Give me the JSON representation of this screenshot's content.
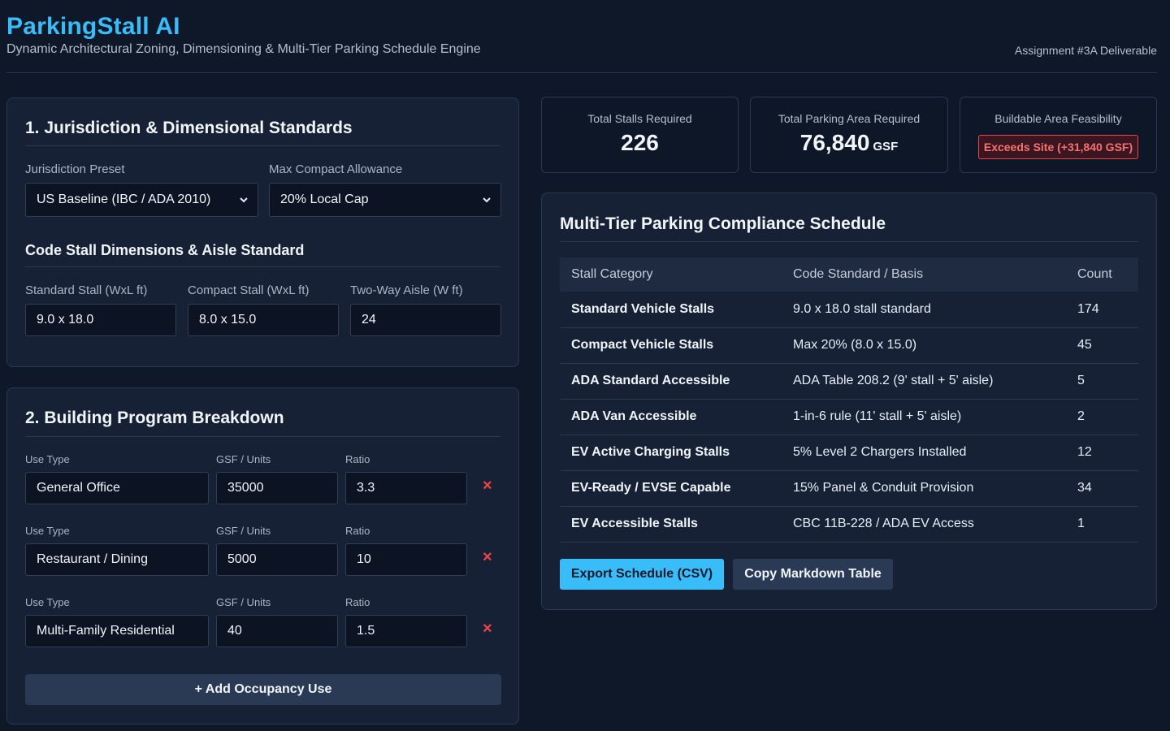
{
  "header": {
    "title": "ParkingStall AI",
    "subtitle": "Dynamic Architectural Zoning, Dimensioning & Multi-Tier Parking Schedule Engine",
    "assignment": "Assignment #3A Deliverable"
  },
  "jurisdiction": {
    "title": "1. Jurisdiction & Dimensional Standards",
    "preset_label": "Jurisdiction Preset",
    "preset_value": "US Baseline (IBC / ADA 2010)",
    "compact_label": "Max Compact Allowance",
    "compact_value": "20% Local Cap",
    "dims_title": "Code Stall Dimensions & Aisle Standard",
    "standard_label": "Standard Stall (WxL ft)",
    "standard_value": "9.0 x 18.0",
    "compact_stall_label": "Compact Stall (WxL ft)",
    "compact_stall_value": "8.0 x 15.0",
    "aisle_label": "Two-Way Aisle (W ft)",
    "aisle_value": "24"
  },
  "program": {
    "title": "2. Building Program Breakdown",
    "rows": [
      {
        "use_label": "Use Type",
        "gsf_label": "GSF / Units",
        "ratio_label": "Ratio",
        "use": "General Office",
        "gsf": "35000",
        "ratio": "3.3",
        "remove": "×"
      },
      {
        "use_label": "Use Type",
        "gsf_label": "GSF / Units",
        "ratio_label": "Ratio",
        "use": "Restaurant / Dining",
        "gsf": "5000",
        "ratio": "10",
        "remove": "×"
      },
      {
        "use_label": "Use Type",
        "gsf_label": "GSF / Units",
        "ratio_label": "Ratio",
        "use": "Multi-Family Residential",
        "gsf": "40",
        "ratio": "1.5",
        "remove": "×"
      }
    ],
    "add_label": "+ Add Occupancy Use"
  },
  "kpis": {
    "stalls_label": "Total Stalls Required",
    "stalls_value": "226",
    "area_label": "Total Parking Area Required",
    "area_value": "76,840",
    "area_unit": "GSF",
    "feasibility_label": "Buildable Area Feasibility",
    "feasibility_badge": "Exceeds Site (+31,840 GSF)",
    "badge_color": "#ef4444"
  },
  "schedule": {
    "title": "Multi-Tier Parking Compliance Schedule",
    "headers": [
      "Stall Category",
      "Code Standard / Basis",
      "Count"
    ],
    "rows": [
      {
        "category": "Standard Vehicle Stalls",
        "basis": "9.0 x 18.0 stall standard",
        "count": "174"
      },
      {
        "category": "Compact Vehicle Stalls",
        "basis": "Max 20% (8.0 x 15.0)",
        "count": "45"
      },
      {
        "category": "ADA Standard Accessible",
        "basis": "ADA Table 208.2 (9' stall + 5' aisle)",
        "count": "5"
      },
      {
        "category": "ADA Van Accessible",
        "basis": "1-in-6 rule (11' stall + 5' aisle)",
        "count": "2"
      },
      {
        "category": "EV Active Charging Stalls",
        "basis": "5% Level 2 Chargers Installed",
        "count": "12"
      },
      {
        "category": "EV-Ready / EVSE Capable",
        "basis": "15% Panel & Conduit Provision",
        "count": "34"
      },
      {
        "category": "EV Accessible Stalls",
        "basis": "CBC 11B-228 / ADA EV Access",
        "count": "1"
      }
    ],
    "export_label": "Export Schedule (CSV)",
    "copy_label": "Copy Markdown Table"
  },
  "colors": {
    "accent": "#38bdf8",
    "danger": "#ef4444",
    "background": "#0f1829",
    "panel": "#162135"
  }
}
